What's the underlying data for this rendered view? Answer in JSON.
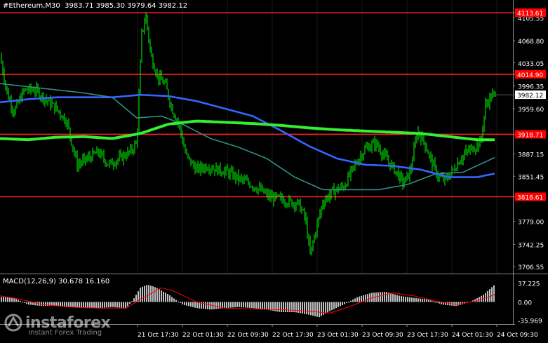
{
  "header": {
    "symbol": "#Ethereum,M30",
    "ohlc": "3983.71 3985.30 3979.64 3982.12"
  },
  "macd_header": "MACD(12,26,9) 30.678 16.160",
  "watermark": {
    "name": "instaforex",
    "tagline": "Instant Forex Trading",
    "icon": "instaforex-logo-icon"
  },
  "colors": {
    "background": "#000000",
    "candle": "#00ff00",
    "ma_fast": "#2f8f86",
    "ma_mid": "#3366ff",
    "ma_slow": "#33ee33",
    "level_line": "#ff2020",
    "level_label_bg": "#ff0000",
    "current_label_bg": "#ffffff",
    "macd_hist": "#c0c0c0",
    "macd_signal": "#ff0000",
    "axis_text": "#ffffff"
  },
  "chart_data": {
    "type": "candlestick",
    "price_axis": {
      "ticks": [
        "4105.55",
        "4068.80",
        "4033.05",
        "3996.35",
        "3959.60",
        "3887.15",
        "3851.45",
        "3779.00",
        "3742.25",
        "3706.55"
      ],
      "ylim": [
        3700,
        4125
      ]
    },
    "time_axis": {
      "labels": [
        "21 Oct 17:30",
        "22 Oct 01:30",
        "22 Oct 09:30",
        "22 Oct 17:30",
        "23 Oct 01:30",
        "23 Oct 09:30",
        "23 Oct 17:30",
        "24 Oct 01:30",
        "24 Oct 09:30"
      ]
    },
    "levels": [
      {
        "label": "4113.61",
        "value": 4113.61
      },
      {
        "label": "4014.90",
        "value": 4014.9
      },
      {
        "label": "3918.71",
        "value": 3918.71
      },
      {
        "label": "3818.61",
        "value": 3818.61
      }
    ],
    "current_price": {
      "label": "3982.12",
      "value": 3982.12
    },
    "price_anchors": [
      [
        0,
        4045
      ],
      [
        10,
        3985
      ],
      [
        20,
        3955
      ],
      [
        35,
        3990
      ],
      [
        50,
        3990
      ],
      [
        65,
        3975
      ],
      [
        80,
        3960
      ],
      [
        95,
        3940
      ],
      [
        110,
        3870
      ],
      [
        125,
        3880
      ],
      [
        140,
        3890
      ],
      [
        155,
        3870
      ],
      [
        170,
        3880
      ],
      [
        185,
        3890
      ],
      [
        195,
        3905
      ],
      [
        202,
        4080
      ],
      [
        208,
        4108
      ],
      [
        215,
        4045
      ],
      [
        225,
        4010
      ],
      [
        235,
        4000
      ],
      [
        245,
        3960
      ],
      [
        255,
        3935
      ],
      [
        265,
        3885
      ],
      [
        280,
        3862
      ],
      [
        295,
        3868
      ],
      [
        310,
        3862
      ],
      [
        325,
        3858
      ],
      [
        340,
        3848
      ],
      [
        355,
        3840
      ],
      [
        370,
        3830
      ],
      [
        385,
        3818
      ],
      [
        400,
        3815
      ],
      [
        415,
        3810
      ],
      [
        425,
        3808
      ],
      [
        435,
        3785
      ],
      [
        442,
        3725
      ],
      [
        450,
        3765
      ],
      [
        460,
        3810
      ],
      [
        475,
        3828
      ],
      [
        490,
        3835
      ],
      [
        505,
        3868
      ],
      [
        520,
        3895
      ],
      [
        535,
        3905
      ],
      [
        550,
        3880
      ],
      [
        565,
        3858
      ],
      [
        575,
        3840
      ],
      [
        585,
        3860
      ],
      [
        595,
        3925
      ],
      [
        605,
        3905
      ],
      [
        615,
        3875
      ],
      [
        625,
        3850
      ],
      [
        635,
        3845
      ],
      [
        645,
        3860
      ],
      [
        655,
        3878
      ],
      [
        665,
        3890
      ],
      [
        675,
        3898
      ],
      [
        685,
        3905
      ],
      [
        692,
        3965
      ],
      [
        700,
        3980
      ],
      [
        706,
        3982
      ]
    ],
    "ma_fast_anchors": [
      [
        0,
        4000
      ],
      [
        40,
        3995
      ],
      [
        80,
        3990
      ],
      [
        120,
        3985
      ],
      [
        160,
        3978
      ],
      [
        195,
        3945
      ],
      [
        230,
        3948
      ],
      [
        260,
        3935
      ],
      [
        300,
        3912
      ],
      [
        340,
        3898
      ],
      [
        380,
        3880
      ],
      [
        420,
        3850
      ],
      [
        460,
        3830
      ],
      [
        500,
        3830
      ],
      [
        540,
        3830
      ],
      [
        580,
        3838
      ],
      [
        620,
        3855
      ],
      [
        660,
        3858
      ],
      [
        706,
        3882
      ]
    ],
    "ma_mid_anchors": [
      [
        0,
        3970
      ],
      [
        40,
        3975
      ],
      [
        80,
        3978
      ],
      [
        120,
        3978
      ],
      [
        160,
        3978
      ],
      [
        200,
        3982
      ],
      [
        240,
        3980
      ],
      [
        280,
        3972
      ],
      [
        320,
        3960
      ],
      [
        360,
        3948
      ],
      [
        400,
        3925
      ],
      [
        440,
        3900
      ],
      [
        480,
        3880
      ],
      [
        520,
        3870
      ],
      [
        560,
        3868
      ],
      [
        600,
        3862
      ],
      [
        640,
        3850
      ],
      [
        680,
        3850
      ],
      [
        706,
        3856
      ]
    ],
    "ma_slow_anchors": [
      [
        0,
        3912
      ],
      [
        40,
        3910
      ],
      [
        80,
        3914
      ],
      [
        120,
        3915
      ],
      [
        160,
        3912
      ],
      [
        200,
        3920
      ],
      [
        240,
        3935
      ],
      [
        280,
        3940
      ],
      [
        320,
        3938
      ],
      [
        360,
        3936
      ],
      [
        400,
        3933
      ],
      [
        440,
        3929
      ],
      [
        480,
        3926
      ],
      [
        520,
        3924
      ],
      [
        560,
        3922
      ],
      [
        600,
        3920
      ],
      [
        640,
        3915
      ],
      [
        680,
        3910
      ],
      [
        706,
        3910
      ]
    ],
    "macd_axis": {
      "ticks": [
        "37.225",
        "0.00",
        "-35.969"
      ],
      "ylim": [
        -42,
        42
      ]
    },
    "macd_hist_anchors": [
      [
        0,
        10
      ],
      [
        20,
        8
      ],
      [
        40,
        -5
      ],
      [
        60,
        -8
      ],
      [
        80,
        -7
      ],
      [
        100,
        -10
      ],
      [
        120,
        -12
      ],
      [
        140,
        -12
      ],
      [
        160,
        -10
      ],
      [
        180,
        -12
      ],
      [
        190,
        5
      ],
      [
        200,
        28
      ],
      [
        210,
        34
      ],
      [
        220,
        30
      ],
      [
        240,
        15
      ],
      [
        260,
        -5
      ],
      [
        280,
        -12
      ],
      [
        300,
        -15
      ],
      [
        320,
        -12
      ],
      [
        340,
        -10
      ],
      [
        360,
        -12
      ],
      [
        380,
        -15
      ],
      [
        400,
        -20
      ],
      [
        420,
        -20
      ],
      [
        440,
        -25
      ],
      [
        455,
        -30
      ],
      [
        470,
        -18
      ],
      [
        490,
        -5
      ],
      [
        510,
        10
      ],
      [
        530,
        18
      ],
      [
        550,
        20
      ],
      [
        570,
        12
      ],
      [
        590,
        8
      ],
      [
        610,
        5
      ],
      [
        630,
        -5
      ],
      [
        650,
        -8
      ],
      [
        670,
        0
      ],
      [
        690,
        15
      ],
      [
        700,
        28
      ],
      [
        706,
        35
      ]
    ],
    "macd_signal_anchors": [
      [
        0,
        12
      ],
      [
        30,
        5
      ],
      [
        60,
        -5
      ],
      [
        100,
        -10
      ],
      [
        140,
        -12
      ],
      [
        180,
        -12
      ],
      [
        200,
        5
      ],
      [
        230,
        28
      ],
      [
        250,
        20
      ],
      [
        280,
        0
      ],
      [
        320,
        -12
      ],
      [
        360,
        -14
      ],
      [
        400,
        -15
      ],
      [
        440,
        -18
      ],
      [
        470,
        -22
      ],
      [
        500,
        -8
      ],
      [
        530,
        8
      ],
      [
        560,
        18
      ],
      [
        590,
        12
      ],
      [
        620,
        2
      ],
      [
        650,
        -5
      ],
      [
        680,
        2
      ],
      [
        706,
        15
      ]
    ]
  }
}
